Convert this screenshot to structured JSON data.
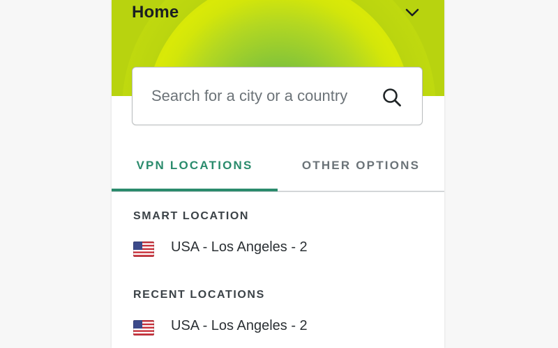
{
  "header": {
    "title": "Home",
    "menu_icon": "chevron-down-icon"
  },
  "search": {
    "placeholder": "Search for a city or a country",
    "value": "",
    "icon": "search-icon"
  },
  "tabs": [
    {
      "label": "VPN LOCATIONS",
      "active": true
    },
    {
      "label": "OTHER OPTIONS",
      "active": false
    }
  ],
  "sections": {
    "smart": {
      "heading": "SMART LOCATION",
      "items": [
        {
          "label": "USA - Los Angeles - 2",
          "flag": "us-flag-icon"
        }
      ]
    },
    "recent": {
      "heading": "RECENT LOCATIONS",
      "items": [
        {
          "label": "USA - Los Angeles - 2",
          "flag": "us-flag-icon"
        }
      ]
    }
  },
  "colors": {
    "accent": "#2a8b6c",
    "header_green": "#b8d30f",
    "text_dark": "#1a1f22",
    "tab_inactive": "#6b7378"
  }
}
